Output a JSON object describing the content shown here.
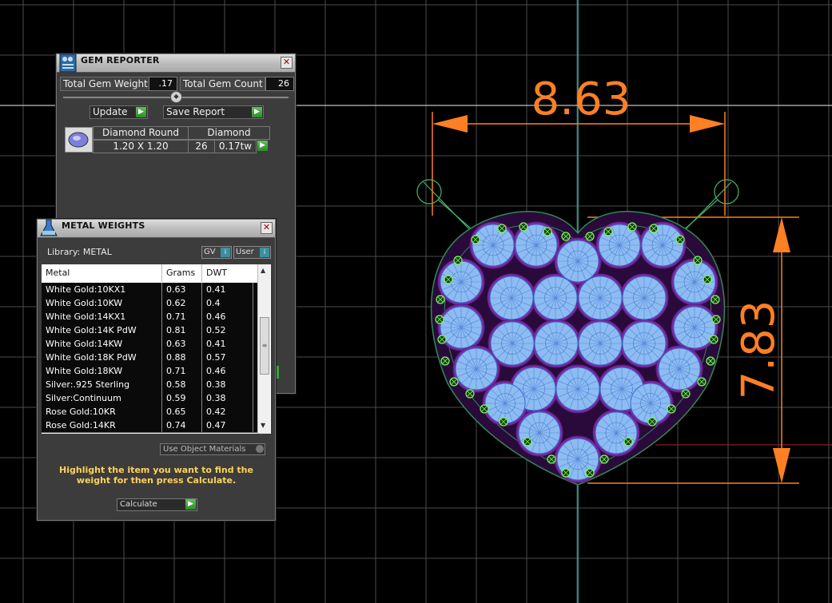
{
  "viewport": {
    "dimension_width": "8.63",
    "dimension_height": "7.83",
    "colors": {
      "background": "#000000",
      "grid": "#4d4d4d",
      "dimension": "#ff7f24",
      "axis": "#20b2aa",
      "gem_fill": "#8cbcf2",
      "gem_outline": "#3c64c8",
      "setting": "#7a2aa0"
    }
  },
  "gem_reporter": {
    "title": "GEM REPORTER",
    "total_weight_label": "Total Gem Weight",
    "total_weight_value": ".17",
    "total_count_label": "Total Gem Count",
    "total_count_value": "26",
    "update_label": "Update",
    "save_report_label": "Save Report",
    "gem": {
      "shape": "Diamond Round",
      "material": "Diamond",
      "size": "1.20 X 1.20",
      "count": "26",
      "weight": "0.17tw"
    }
  },
  "metal_weights": {
    "title": "METAL WEIGHTS",
    "library_label": "Library: METAL",
    "gv_label": "GV",
    "user_label": "User",
    "columns": [
      "Metal",
      "Grams",
      "DWT"
    ],
    "rows": [
      {
        "metal": "White Gold:10KX1",
        "grams": "0.63",
        "dwt": "0.41"
      },
      {
        "metal": "White Gold:10KW",
        "grams": "0.62",
        "dwt": "0.4"
      },
      {
        "metal": "White Gold:14KX1",
        "grams": "0.71",
        "dwt": "0.46"
      },
      {
        "metal": "White Gold:14K PdW",
        "grams": "0.81",
        "dwt": "0.52"
      },
      {
        "metal": "White Gold:14KW",
        "grams": "0.63",
        "dwt": "0.41"
      },
      {
        "metal": "White Gold:18K PdW",
        "grams": "0.88",
        "dwt": "0.57"
      },
      {
        "metal": "White Gold:18KW",
        "grams": "0.71",
        "dwt": "0.46"
      },
      {
        "metal": "Silver:.925 Sterling",
        "grams": "0.58",
        "dwt": "0.38"
      },
      {
        "metal": "Silver:Continuum",
        "grams": "0.59",
        "dwt": "0.38"
      },
      {
        "metal": "Rose Gold:10KR",
        "grams": "0.65",
        "dwt": "0.42"
      },
      {
        "metal": "Rose Gold:14KR",
        "grams": "0.74",
        "dwt": "0.47"
      }
    ],
    "use_object_materials": "Use Object Materials",
    "hint": "Highlight the item you want to find the weight for then press Calculate.",
    "calculate_label": "Calculate"
  }
}
